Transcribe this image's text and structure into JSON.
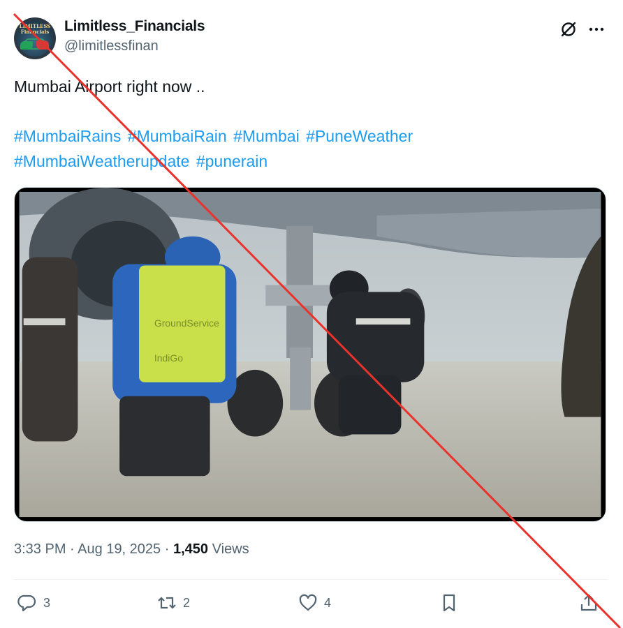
{
  "author": {
    "display_name": "Limitless_Financials",
    "handle": "@limitlessfinan",
    "avatar_text": "LIMITLESS Financials"
  },
  "header": {
    "grok_icon": "grok-slash-circle-icon",
    "more_icon": "more-dots-icon"
  },
  "tweet": {
    "text": "Mumbai Airport right now ..",
    "hashtags": [
      "#MumbaiRains",
      "#MumbaiRain",
      "#Mumbai",
      "#PuneWeather",
      "#MumbaiWeatherupdate",
      "#punerain"
    ]
  },
  "media": {
    "description_icon": "video-thumbnail",
    "vest_text": "GroundService",
    "vest_brand": "IndiGo"
  },
  "meta": {
    "time": "3:33 PM",
    "separator": "·",
    "date": "Aug 19, 2025",
    "views_count": "1,450",
    "views_label": "Views"
  },
  "actions": {
    "reply_count": "3",
    "repost_count": "2",
    "like_count": "4"
  },
  "colors": {
    "link": "#1d9bf0",
    "secondary_text": "#536471",
    "strike_line": "#e8322b"
  }
}
